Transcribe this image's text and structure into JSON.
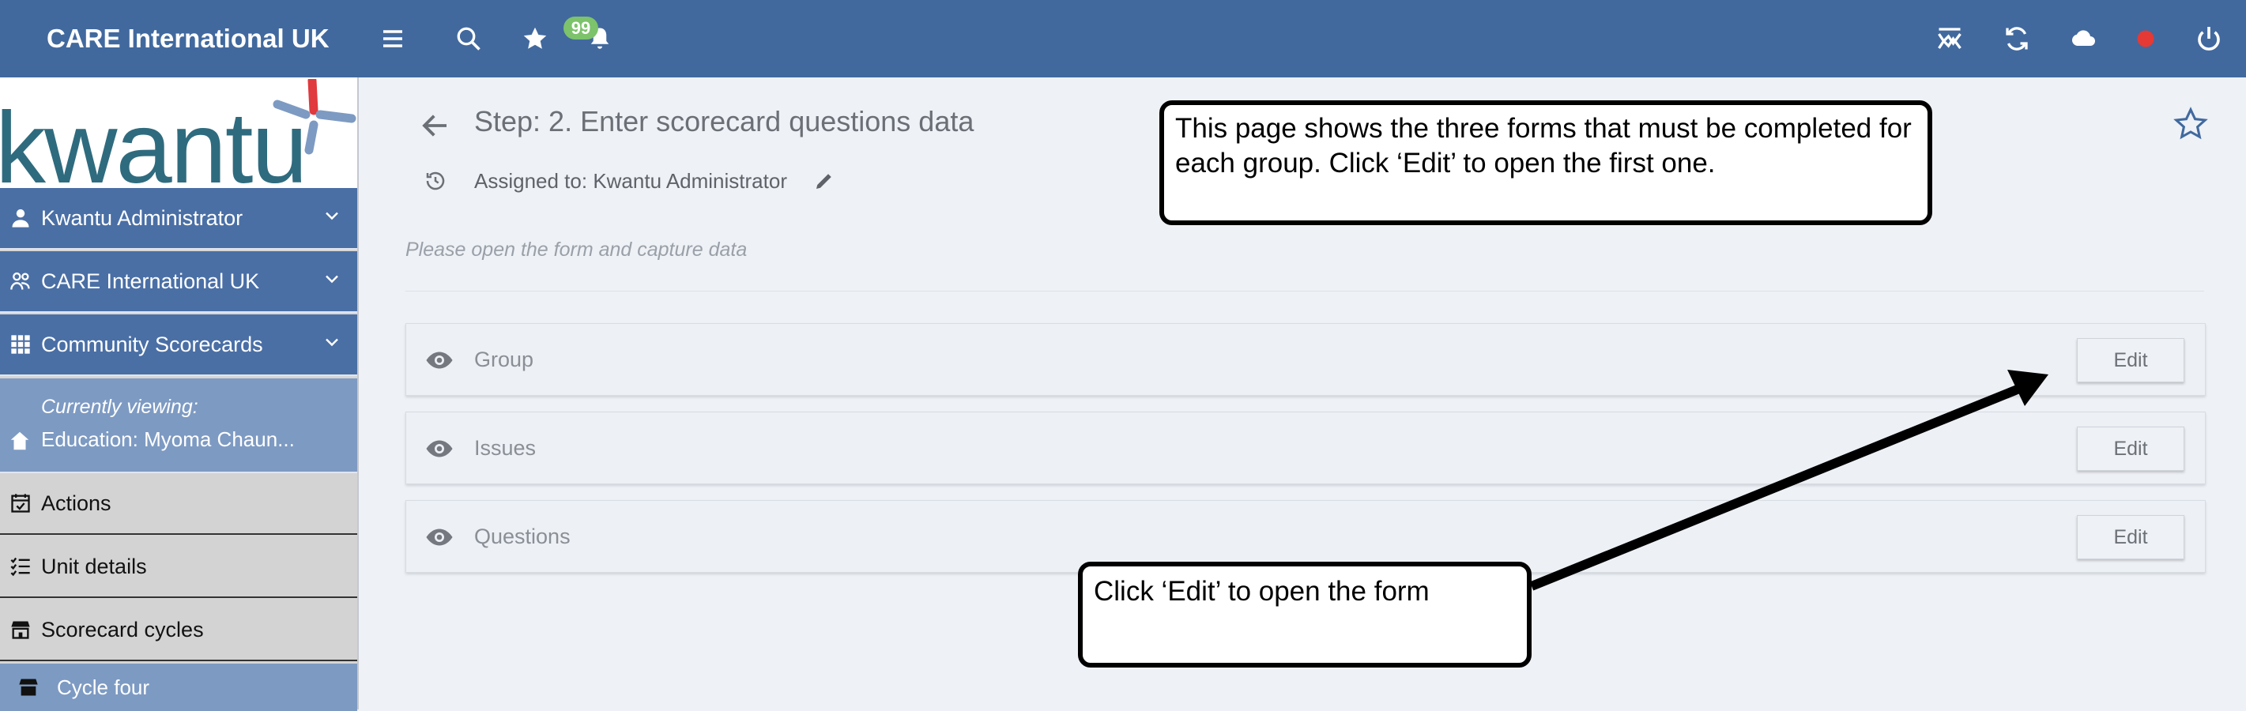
{
  "topbar": {
    "brand": "CARE International UK",
    "notification_count": "99",
    "icons": [
      "menu-icon",
      "search-icon",
      "star-icon",
      "bell-icon",
      "analytics-icon",
      "sync-icon",
      "cloud-icon",
      "status-dot-icon",
      "power-icon"
    ],
    "background": "#41699e"
  },
  "sidebar": {
    "logo_text": "kwantu",
    "items": [
      {
        "label": "Kwantu Administrator",
        "icon": "user-icon"
      },
      {
        "label": "CARE International UK",
        "icon": "organisation-icon"
      },
      {
        "label": "Community Scorecards",
        "icon": "apps-grid-icon"
      }
    ],
    "viewing": {
      "label": "Currently viewing:",
      "value": "Education: Myoma Chaun..."
    },
    "links": [
      {
        "label": "Actions",
        "icon": "calendar-check-icon"
      },
      {
        "label": "Unit details",
        "icon": "checklist-icon"
      },
      {
        "label": "Scorecard cycles",
        "icon": "store-icon"
      }
    ],
    "sub_item": {
      "label": "Cycle four",
      "icon": "store-icon"
    }
  },
  "main": {
    "title": "Step: 2. Enter scorecard questions data",
    "assigned": "Assigned to: Kwantu Administrator",
    "hint": "Please open the form and capture data",
    "forms": [
      {
        "name": "Group",
        "action": "Edit"
      },
      {
        "name": "Issues",
        "action": "Edit"
      },
      {
        "name": "Questions",
        "action": "Edit"
      }
    ]
  },
  "annotations": {
    "callout_top": "This page shows the three forms that must be completed for each group.  Click ‘Edit’ to open the first one.",
    "callout_bottom": "Click ‘Edit’ to open the form"
  },
  "colors": {
    "primary": "#41699e",
    "sidebar_blue": "#4a6fa5",
    "viewing_blue": "#7d9ac2",
    "badge_green": "#7cc36b",
    "status_red": "#e53935"
  }
}
